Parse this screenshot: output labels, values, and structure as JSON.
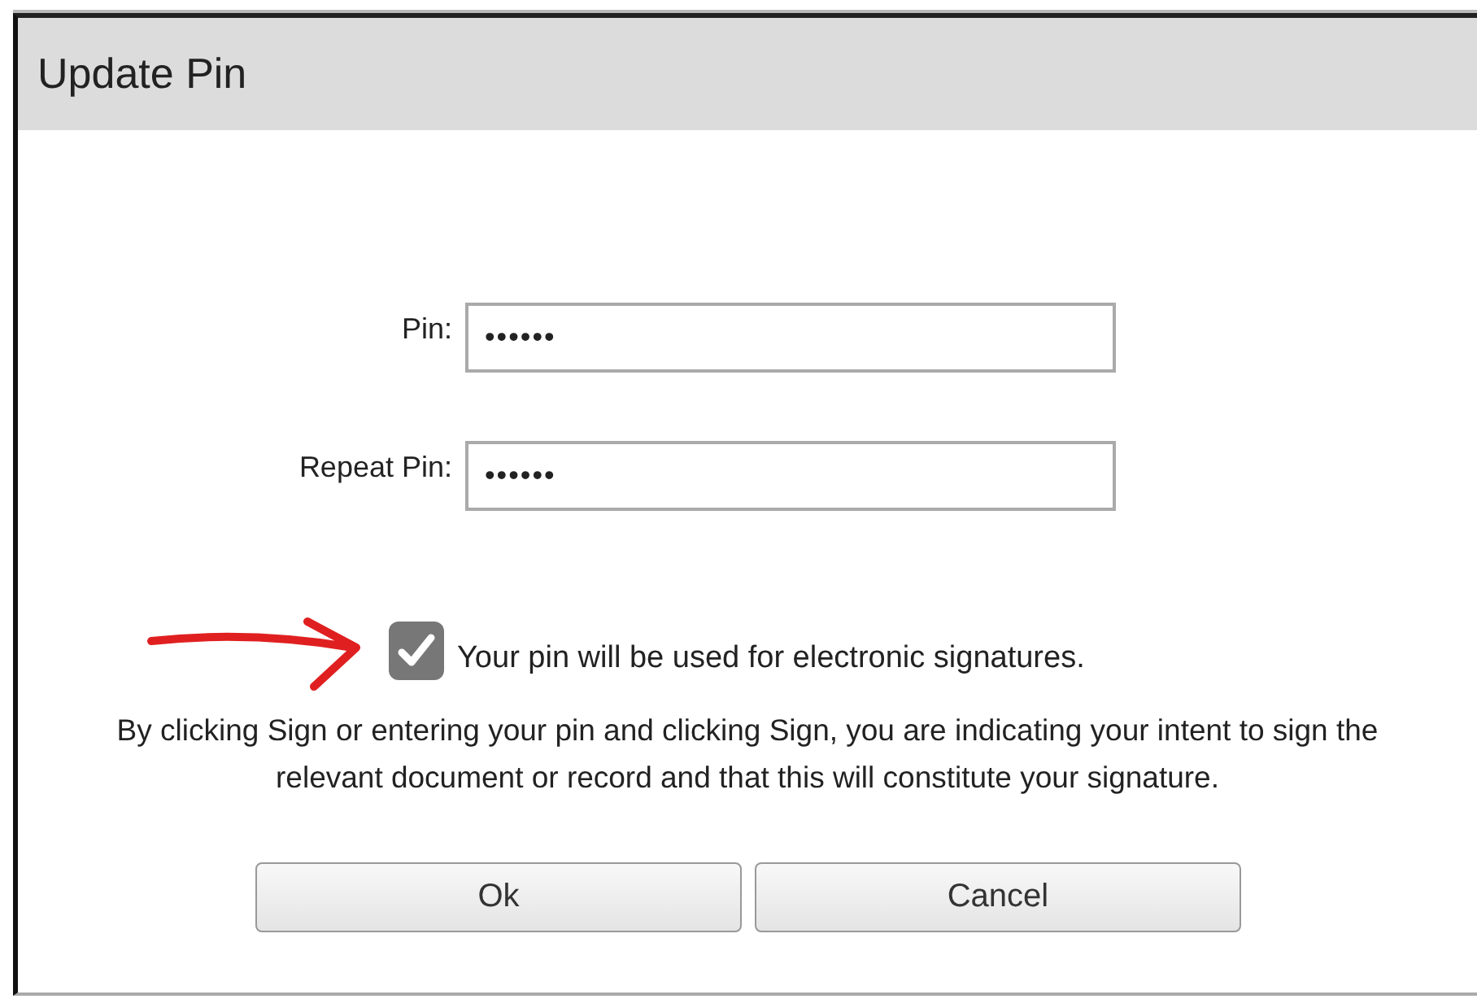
{
  "window": {
    "title": "Update Pin"
  },
  "fields": [
    {
      "label": "Pin:",
      "value": "••••••"
    },
    {
      "label": "Repeat Pin:",
      "value": "••••••"
    }
  ],
  "consent": {
    "checked": true,
    "label": "Your pin will be used for electronic signatures."
  },
  "notice": "By clicking Sign or entering your pin and clicking Sign, you are indicating your intent to sign the relevant document or record and that this will constitute your signature.",
  "buttons": [
    "Ok",
    "Cancel"
  ]
}
